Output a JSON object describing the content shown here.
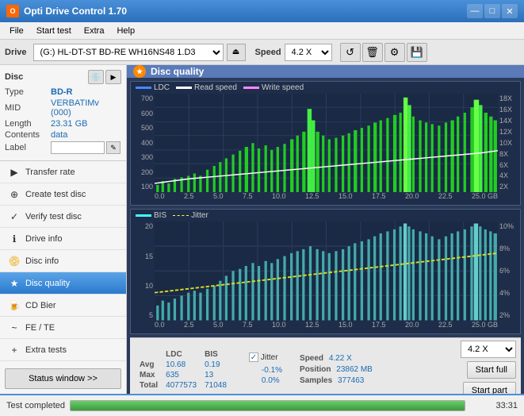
{
  "titlebar": {
    "title": "Opti Drive Control 1.70",
    "icon_label": "O",
    "min_btn": "—",
    "max_btn": "□",
    "close_btn": "✕"
  },
  "menubar": {
    "items": [
      "File",
      "Start test",
      "Extra",
      "Help"
    ]
  },
  "drivebar": {
    "drive_label": "Drive",
    "drive_value": "(G:)  HL-DT-ST BD-RE  WH16NS48 1.D3",
    "speed_label": "Speed",
    "speed_value": "4.2 X"
  },
  "disc_panel": {
    "title": "Disc",
    "type_label": "Type",
    "type_value": "BD-R",
    "mid_label": "MID",
    "mid_value": "VERBATIMv (000)",
    "length_label": "Length",
    "length_value": "23.31 GB",
    "contents_label": "Contents",
    "contents_value": "data",
    "label_label": "Label"
  },
  "nav_items": [
    {
      "id": "transfer-rate",
      "label": "Transfer rate",
      "icon": "▶"
    },
    {
      "id": "create-test-disc",
      "label": "Create test disc",
      "icon": "💿"
    },
    {
      "id": "verify-test-disc",
      "label": "Verify test disc",
      "icon": "✓"
    },
    {
      "id": "drive-info",
      "label": "Drive info",
      "icon": "ℹ"
    },
    {
      "id": "disc-info",
      "label": "Disc info",
      "icon": "📀"
    },
    {
      "id": "disc-quality",
      "label": "Disc quality",
      "icon": "★",
      "active": true
    },
    {
      "id": "cd-bier",
      "label": "CD Bier",
      "icon": "🍺"
    },
    {
      "id": "fe-te",
      "label": "FE / TE",
      "icon": "~"
    },
    {
      "id": "extra-tests",
      "label": "Extra tests",
      "icon": "+"
    }
  ],
  "status_btn": "Status window >>",
  "content": {
    "header_title": "Disc quality",
    "chart1": {
      "legend": [
        {
          "label": "LDC",
          "color": "#4488ff"
        },
        {
          "label": "Read speed",
          "color": "#ffffff"
        },
        {
          "label": "Write speed",
          "color": "#ff88ff"
        }
      ],
      "y_labels_left": [
        "700",
        "600",
        "500",
        "400",
        "300",
        "200",
        "100"
      ],
      "y_labels_right": [
        "18X",
        "16X",
        "14X",
        "12X",
        "10X",
        "8X",
        "6X",
        "4X",
        "2X"
      ],
      "x_labels": [
        "0.0",
        "2.5",
        "5.0",
        "7.5",
        "10.0",
        "12.5",
        "15.0",
        "17.5",
        "20.0",
        "22.5",
        "25.0 GB"
      ]
    },
    "chart2": {
      "legend": [
        {
          "label": "BIS",
          "color": "#44ffff"
        },
        {
          "label": "Jitter",
          "color": "#ffff44"
        }
      ],
      "y_labels_left": [
        "20",
        "15",
        "10",
        "5"
      ],
      "y_labels_right": [
        "10%",
        "8%",
        "6%",
        "4%",
        "2%"
      ],
      "x_labels": [
        "0.0",
        "2.5",
        "5.0",
        "7.5",
        "10.0",
        "12.5",
        "15.0",
        "17.5",
        "20.0",
        "22.5",
        "25.0 GB"
      ]
    }
  },
  "stats": {
    "col_ldc": "LDC",
    "col_bis": "BIS",
    "jitter_label": "Jitter",
    "speed_label": "Speed",
    "speed_value": "4.22 X",
    "speed_select": "4.2 X",
    "avg_label": "Avg",
    "avg_ldc": "10.68",
    "avg_bis": "0.19",
    "avg_jitter": "-0.1%",
    "max_label": "Max",
    "max_ldc": "635",
    "max_bis": "13",
    "max_jitter": "0.0%",
    "total_label": "Total",
    "total_ldc": "4077573",
    "total_bis": "71048",
    "position_label": "Position",
    "position_value": "23862 MB",
    "samples_label": "Samples",
    "samples_value": "377463",
    "start_full_btn": "Start full",
    "start_part_btn": "Start part"
  },
  "statusbar": {
    "text": "Test completed",
    "progress": 100,
    "time": "33:31"
  }
}
